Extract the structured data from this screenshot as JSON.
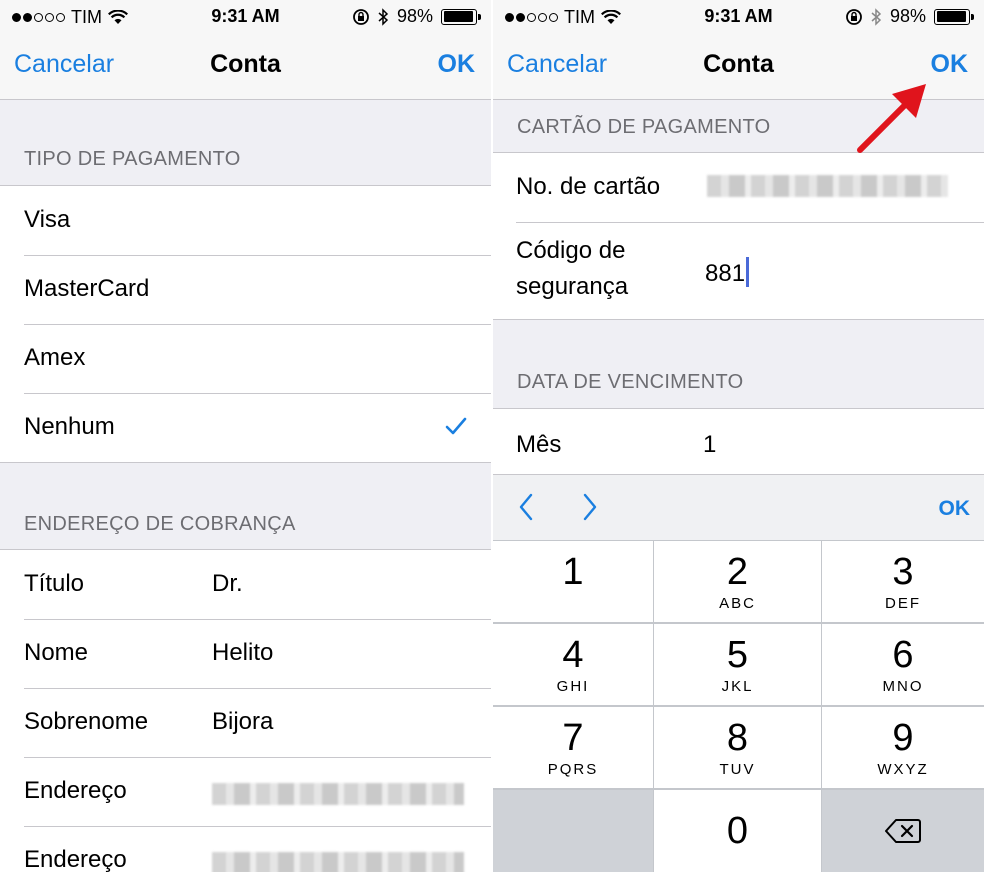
{
  "status": {
    "carrier": "TIM",
    "time": "9:31 AM",
    "battery": "98%",
    "signal_dots": [
      true,
      true,
      false,
      false,
      false
    ],
    "icons": [
      "wifi-icon",
      "rotation-lock-icon",
      "bluetooth-icon",
      "battery-icon"
    ]
  },
  "nav": {
    "cancel": "Cancelar",
    "title": "Conta",
    "ok": "OK"
  },
  "left": {
    "payment_header": "TIPO DE PAGAMENTO",
    "payment_options": [
      "Visa",
      "MasterCard",
      "Amex",
      "Nenhum"
    ],
    "selected_option": "Nenhum",
    "billing_header": "ENDEREÇO DE COBRANÇA",
    "billing_rows": [
      {
        "label": "Título",
        "value": "Dr."
      },
      {
        "label": "Nome",
        "value": "Helito"
      },
      {
        "label": "Sobrenome",
        "value": "Bijora"
      },
      {
        "label": "Endereço",
        "value": ""
      },
      {
        "label": "Endereço",
        "value": ""
      }
    ]
  },
  "right": {
    "card_header": "CARTÃO DE PAGAMENTO",
    "card_number_label": "No. de cartão",
    "security_label_1": "Código de",
    "security_label_2": "segurança",
    "security_value": "881",
    "expiry_header": "DATA DE VENCIMENTO",
    "month_label": "Mês",
    "month_value": "1",
    "toolbar_ok": "OK"
  },
  "keypad": [
    {
      "num": "1",
      "sub": ""
    },
    {
      "num": "2",
      "sub": "ABC"
    },
    {
      "num": "3",
      "sub": "DEF"
    },
    {
      "num": "4",
      "sub": "GHI"
    },
    {
      "num": "5",
      "sub": "JKL"
    },
    {
      "num": "6",
      "sub": "MNO"
    },
    {
      "num": "7",
      "sub": "PQRS"
    },
    {
      "num": "8",
      "sub": "TUV"
    },
    {
      "num": "9",
      "sub": "WXYZ"
    },
    {
      "num": "0",
      "sub": ""
    }
  ],
  "colors": {
    "accent": "#1a7fe0",
    "annotation_arrow": "#e0141c",
    "cursor": "#4a6ad8"
  }
}
